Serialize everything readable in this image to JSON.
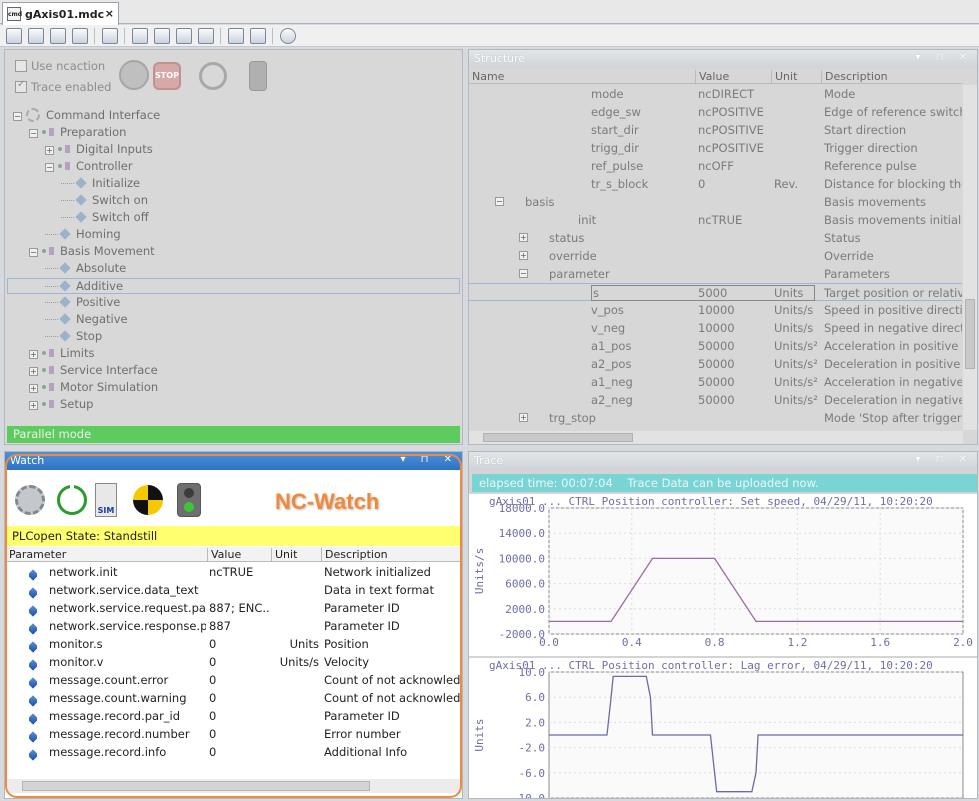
{
  "document_tab": {
    "label": "gAxis01.mdc",
    "icon_text": "cmd",
    "close": "×"
  },
  "command_panel": {
    "checkboxes": [
      {
        "label": "Use ncaction",
        "checked": false
      },
      {
        "label": "Trace enabled",
        "checked": true
      }
    ],
    "status_bar": "Parallel mode",
    "tree": [
      {
        "label": "Command Interface",
        "level": 0,
        "type": "root"
      },
      {
        "label": "Preparation",
        "level": 1,
        "type": "node"
      },
      {
        "label": "Digital Inputs",
        "level": 2,
        "type": "node"
      },
      {
        "label": "Controller",
        "level": 2,
        "type": "node"
      },
      {
        "label": "Initialize",
        "level": 3,
        "type": "leaf"
      },
      {
        "label": "Switch on",
        "level": 3,
        "type": "leaf"
      },
      {
        "label": "Switch off",
        "level": 3,
        "type": "leaf"
      },
      {
        "label": "Homing",
        "level": 2,
        "type": "leaf"
      },
      {
        "label": "Basis Movement",
        "level": 1,
        "type": "node"
      },
      {
        "label": "Absolute",
        "level": 2,
        "type": "leaf"
      },
      {
        "label": "Additive",
        "level": 2,
        "type": "leaf",
        "selected": true
      },
      {
        "label": "Positive",
        "level": 2,
        "type": "leaf"
      },
      {
        "label": "Negative",
        "level": 2,
        "type": "leaf"
      },
      {
        "label": "Stop",
        "level": 2,
        "type": "leaf"
      },
      {
        "label": "Limits",
        "level": 1,
        "type": "node"
      },
      {
        "label": "Service Interface",
        "level": 1,
        "type": "node"
      },
      {
        "label": "Motor Simulation",
        "level": 1,
        "type": "node"
      },
      {
        "label": "Setup",
        "level": 1,
        "type": "node"
      }
    ]
  },
  "structure_panel": {
    "title": "Structure",
    "columns": [
      "Name",
      "Value",
      "Unit",
      "Description"
    ],
    "rows": [
      {
        "name": "mode",
        "value": "ncDIRECT",
        "unit": "",
        "desc": "Mode",
        "indent": 2,
        "kind": "leaf"
      },
      {
        "name": "edge_sw",
        "value": "ncPOSITIVE",
        "unit": "",
        "desc": "Edge of reference switch",
        "indent": 2,
        "kind": "leaf"
      },
      {
        "name": "start_dir",
        "value": "ncPOSITIVE",
        "unit": "",
        "desc": "Start direction",
        "indent": 2,
        "kind": "leaf"
      },
      {
        "name": "trigg_dir",
        "value": "ncPOSITIVE",
        "unit": "",
        "desc": "Trigger direction",
        "indent": 2,
        "kind": "leaf"
      },
      {
        "name": "ref_pulse",
        "value": "ncOFF",
        "unit": "",
        "desc": "Reference pulse",
        "indent": 2,
        "kind": "leaf"
      },
      {
        "name": "tr_s_block",
        "value": "0",
        "unit": "Rev.",
        "desc": "Distance for blocking the acti",
        "indent": 2,
        "kind": "leaf"
      },
      {
        "name": "basis",
        "value": "",
        "unit": "",
        "desc": "Basis movements",
        "indent": 0,
        "kind": "folder",
        "expander": "−"
      },
      {
        "name": "init",
        "value": "ncTRUE",
        "unit": "",
        "desc": "Basis movements initialized",
        "indent": 1,
        "kind": "lock"
      },
      {
        "name": "status",
        "value": "",
        "unit": "",
        "desc": "Status",
        "indent": 1,
        "kind": "folder",
        "expander": "+"
      },
      {
        "name": "override",
        "value": "",
        "unit": "",
        "desc": "Override",
        "indent": 1,
        "kind": "folder",
        "expander": "+"
      },
      {
        "name": "parameter",
        "value": "",
        "unit": "",
        "desc": "Parameters",
        "indent": 1,
        "kind": "folder",
        "expander": "−"
      },
      {
        "name": "s",
        "value": "5000",
        "unit": "Units",
        "desc": "Target position or relative mo",
        "indent": 2,
        "kind": "leaf",
        "selected": true
      },
      {
        "name": "v_pos",
        "value": "10000",
        "unit": "Units/s",
        "desc": "Speed in positive direction",
        "indent": 2,
        "kind": "leaf"
      },
      {
        "name": "v_neg",
        "value": "10000",
        "unit": "Units/s",
        "desc": "Speed in negative direction",
        "indent": 2,
        "kind": "leaf"
      },
      {
        "name": "a1_pos",
        "value": "50000",
        "unit": "Units/s²",
        "desc": "Acceleration in positive direct",
        "indent": 2,
        "kind": "leaf"
      },
      {
        "name": "a2_pos",
        "value": "50000",
        "unit": "Units/s²",
        "desc": "Deceleration in positive direct",
        "indent": 2,
        "kind": "leaf"
      },
      {
        "name": "a1_neg",
        "value": "50000",
        "unit": "Units/s²",
        "desc": "Acceleration in negative direc",
        "indent": 2,
        "kind": "leaf"
      },
      {
        "name": "a2_neg",
        "value": "50000",
        "unit": "Units/s²",
        "desc": "Deceleration in negative direc",
        "indent": 2,
        "kind": "leaf"
      },
      {
        "name": "trg_stop",
        "value": "",
        "unit": "",
        "desc": "Mode 'Stop after trigger'",
        "indent": 1,
        "kind": "folder",
        "expander": "+"
      }
    ]
  },
  "watch_panel": {
    "title": "Watch",
    "watermark": "NC-Watch",
    "sim_label": "SIM",
    "state": "PLCopen State: Standstill",
    "columns": [
      "Parameter",
      "Value",
      "Unit",
      "Description"
    ],
    "rows": [
      {
        "param": "network.init",
        "value": "ncTRUE",
        "unit": "",
        "desc": "Network initialized"
      },
      {
        "param": "network.service.data_text",
        "value": "",
        "unit": "",
        "desc": "Data in text format"
      },
      {
        "param": "network.service.request.par_id",
        "value": "887; ENC...",
        "unit": "",
        "desc": "Parameter ID"
      },
      {
        "param": "network.service.response.par_id",
        "value": "887",
        "unit": "",
        "desc": "Parameter ID"
      },
      {
        "param": "monitor.s",
        "value": "0",
        "unit": "Units",
        "desc": "Position"
      },
      {
        "param": "monitor.v",
        "value": "0",
        "unit": "Units/s",
        "desc": "Velocity"
      },
      {
        "param": "message.count.error",
        "value": "0",
        "unit": "",
        "desc": "Count of not acknowledged e"
      },
      {
        "param": "message.count.warning",
        "value": "0",
        "unit": "",
        "desc": "Count of not acknowledged w"
      },
      {
        "param": "message.record.par_id",
        "value": "0",
        "unit": "",
        "desc": "Parameter ID"
      },
      {
        "param": "message.record.number",
        "value": "0",
        "unit": "",
        "desc": "Error number"
      },
      {
        "param": "message.record.info",
        "value": "0",
        "unit": "",
        "desc": "Additional Info"
      }
    ]
  },
  "trace_panel": {
    "title": "Trace",
    "status": "elapsed time: 00:07:04    Trace Data can be uploaded now."
  },
  "chart_data": [
    {
      "type": "line",
      "title": "gAxis01 ... CTRL Position controller: Set speed, 04/29/11, 10:20:20",
      "ylabel": "Units/s",
      "xlabel": "",
      "xlim": [
        0,
        2.0
      ],
      "ylim": [
        -2000,
        18000
      ],
      "xticks": [
        "0.0",
        "0.4",
        "0.8",
        "1.2",
        "1.6",
        "2.0"
      ],
      "yticks": [
        "18000.0",
        "14000.0",
        "10000.0",
        "6000.0",
        "2000.0",
        "-2000.0"
      ],
      "ytick_values": [
        18000,
        14000,
        10000,
        6000,
        2000,
        -2000
      ],
      "x": [
        0.0,
        0.3,
        0.5,
        0.8,
        1.0,
        2.0
      ],
      "y": [
        0,
        0,
        10000,
        10000,
        0,
        0
      ],
      "color": "#9a6aa6"
    },
    {
      "type": "line",
      "title": "gAxis01 ... CTRL Position controller: Lag error, 04/29/11, 10:20:20",
      "ylabel": "Units",
      "xlabel": "",
      "xlim": [
        0,
        2.0
      ],
      "ylim": [
        -10,
        10
      ],
      "yticks": [
        "10.0",
        "6.0",
        "2.0",
        "-2.0",
        "-6.0",
        "-10.0"
      ],
      "ytick_values": [
        10,
        6,
        2,
        -2,
        -6,
        -10
      ],
      "x": [
        0.0,
        0.28,
        0.3,
        0.31,
        0.47,
        0.49,
        0.5,
        0.78,
        0.8,
        0.81,
        0.98,
        1.0,
        1.01,
        2.0
      ],
      "y": [
        0,
        0,
        6,
        9.3,
        9.3,
        6,
        0,
        0,
        -6,
        -9,
        -9,
        -6,
        0,
        0
      ],
      "color": "#6a6aa6"
    }
  ]
}
